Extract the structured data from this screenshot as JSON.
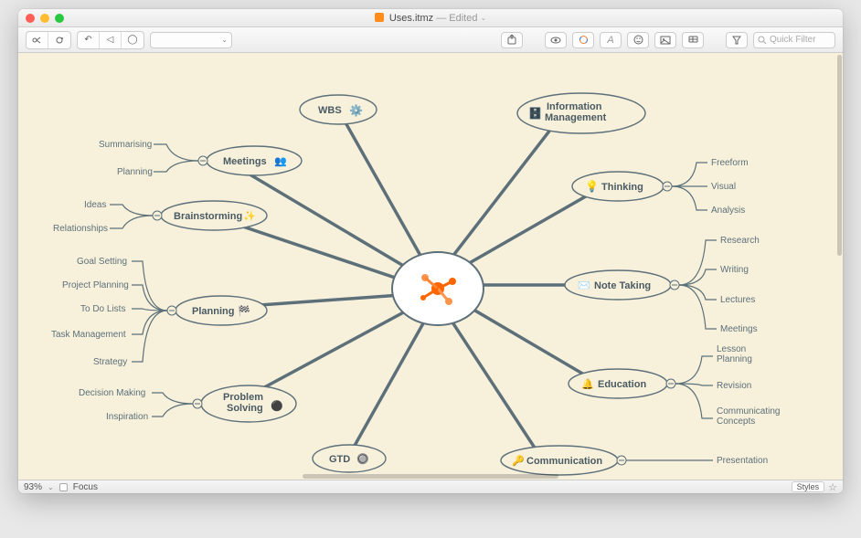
{
  "window": {
    "filename": "Uses.itmz",
    "edited_label": "— Edited",
    "title_dropdown_icon": "chevron-down"
  },
  "toolbar": {
    "search_placeholder": "Quick Filter"
  },
  "statusbar": {
    "zoom": "93%",
    "focus_label": "Focus",
    "styles_label": "Styles"
  },
  "mindmap": {
    "center": {
      "label": "",
      "icon": "hub-icon"
    },
    "nodes": [
      {
        "id": "meetings",
        "label": "Meetings",
        "icon": "people-icon",
        "children": [
          "Summarising",
          "Planning"
        ]
      },
      {
        "id": "brainstorming",
        "label": "Brainstorming",
        "icon": "spark-icon",
        "children": [
          "Ideas",
          "Relationships"
        ]
      },
      {
        "id": "planning",
        "label": "Planning",
        "icon": "flag-icon",
        "children": [
          "Goal Setting",
          "Project Planning",
          "To Do Lists",
          "Task Management",
          "Strategy"
        ]
      },
      {
        "id": "problem_solving",
        "label": "Problem\nSolving",
        "icon": "disc-icon",
        "children": [
          "Decision Making",
          "Inspiration"
        ]
      },
      {
        "id": "gtd",
        "label": "GTD",
        "icon": "target-icon",
        "children": []
      },
      {
        "id": "wbs",
        "label": "WBS",
        "icon": "gears-icon",
        "children": []
      },
      {
        "id": "info_mgmt",
        "label": "Information\nManagement",
        "icon": "database-icon",
        "children": []
      },
      {
        "id": "thinking",
        "label": "Thinking",
        "icon": "bulb-icon",
        "children": [
          "Freeform",
          "Visual",
          "Analysis"
        ]
      },
      {
        "id": "note_taking",
        "label": "Note Taking",
        "icon": "envelope-icon",
        "children": [
          "Research",
          "Writing",
          "Lectures",
          "Meetings"
        ]
      },
      {
        "id": "education",
        "label": "Education",
        "icon": "bell-icon",
        "children": [
          "Lesson Planning",
          "Revision",
          "Communicating Concepts"
        ]
      },
      {
        "id": "communication",
        "label": "Communication",
        "icon": "key-icon",
        "children": [
          "Presentation"
        ]
      }
    ]
  }
}
